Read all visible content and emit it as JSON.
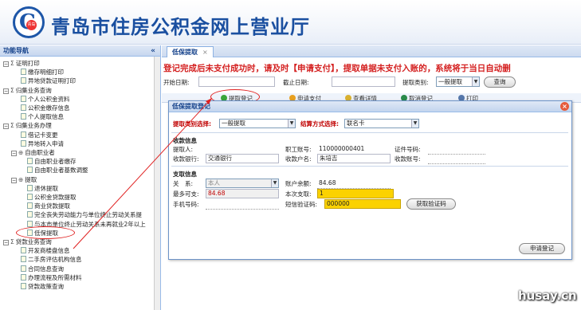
{
  "header": {
    "title": "青岛市住房公积金网上营业厅",
    "logo_text": "C",
    "logo_inner": "青岛"
  },
  "sidebar": {
    "title": "功能导航",
    "collapse": "«",
    "nodes": [
      {
        "label": "证明打印",
        "type": "group"
      },
      {
        "label": "缴存明细打印",
        "type": "leaf"
      },
      {
        "label": "异地贷款证明打印",
        "type": "leaf"
      },
      {
        "label": "归集业务查询",
        "type": "group"
      },
      {
        "label": "个人公积金资料",
        "type": "leaf"
      },
      {
        "label": "公积金缴存信息",
        "type": "leaf"
      },
      {
        "label": "个人提取信息",
        "type": "leaf"
      },
      {
        "label": "归集业务办理",
        "type": "group"
      },
      {
        "label": "借记卡变更",
        "type": "leaf"
      },
      {
        "label": "异地转入申请",
        "type": "leaf"
      },
      {
        "label": "自由职业者",
        "type": "folder"
      },
      {
        "label": "自由职业者缴存",
        "type": "leaf"
      },
      {
        "label": "自由职业者基数调整",
        "type": "leaf"
      },
      {
        "label": "提取",
        "type": "folder"
      },
      {
        "label": "退休提取",
        "type": "leaf"
      },
      {
        "label": "公积金贷款提取",
        "type": "leaf"
      },
      {
        "label": "商业贷款提取",
        "type": "leaf"
      },
      {
        "label": "完全丧失劳动能力与单位终止劳动关系提",
        "type": "leaf"
      },
      {
        "label": "与本市单位终止劳动关系未再就业2年以上",
        "type": "leaf"
      },
      {
        "label": "低保提取",
        "type": "leaf"
      },
      {
        "label": "贷款业务查询",
        "type": "group"
      },
      {
        "label": "开发商楼盘信息",
        "type": "leaf"
      },
      {
        "label": "二手房评估机构信息",
        "type": "leaf"
      },
      {
        "label": "合同信息查询",
        "type": "leaf"
      },
      {
        "label": "办理流程及所需材料",
        "type": "leaf"
      },
      {
        "label": "贷款政策查询",
        "type": "leaf"
      }
    ]
  },
  "main": {
    "tab": {
      "label": "低保提取",
      "close": "×"
    },
    "notice": "登记完成后未支付成功时，请及时【申请支付】，提取单据未支付入账的，系统将于当日自动删",
    "filter": {
      "start_label": "开始日期:",
      "end_label": "截止日期:",
      "type_label": "提取类别:",
      "type_value": "一般提取",
      "query": "查询"
    },
    "toolbar": [
      {
        "label": "提取登记"
      },
      {
        "label": "申请支付"
      },
      {
        "label": "查看详情"
      },
      {
        "label": "取消登记"
      },
      {
        "label": "打印"
      }
    ]
  },
  "dialog": {
    "title": "低保提取登记",
    "close": "×",
    "row1": {
      "type_label": "提取类别选择:",
      "type_value": "一般提取",
      "settle_label": "结算方式选择:",
      "settle_value": "联名卡"
    },
    "section_receive": "收款信息",
    "receive": {
      "name_label": "提取人:",
      "name_value": "",
      "account_label": "职工账号:",
      "account_value": "110000000401",
      "cert_label": "证件号码:",
      "cert_value": "",
      "bank_label": "收款银行:",
      "bank_value": "交通银行",
      "holder_label": "收款户名:",
      "holder_value": "朱培吉",
      "acct_label": "收款账号:",
      "acct_value": ""
    },
    "section_pay": "支取信息",
    "pay": {
      "relation_label": "关　系:",
      "relation_value": "本人",
      "balance_label": "账户余额:",
      "balance_value": "84.68",
      "max_label": "最多可支:",
      "max_value": "84.68",
      "this_label": "本次支取:",
      "this_value": "1",
      "phone_label": "手机号码:",
      "phone_value": "",
      "sms_label": "短信验证码:",
      "sms_value": "000000",
      "get_code": "获取验证码"
    },
    "submit": "申请登记"
  },
  "watermark": "husay.cn",
  "colors": {
    "title": "#1a4fa0",
    "notice": "#d42020",
    "highlight": "#fbd200",
    "annotation": "#e02020"
  }
}
